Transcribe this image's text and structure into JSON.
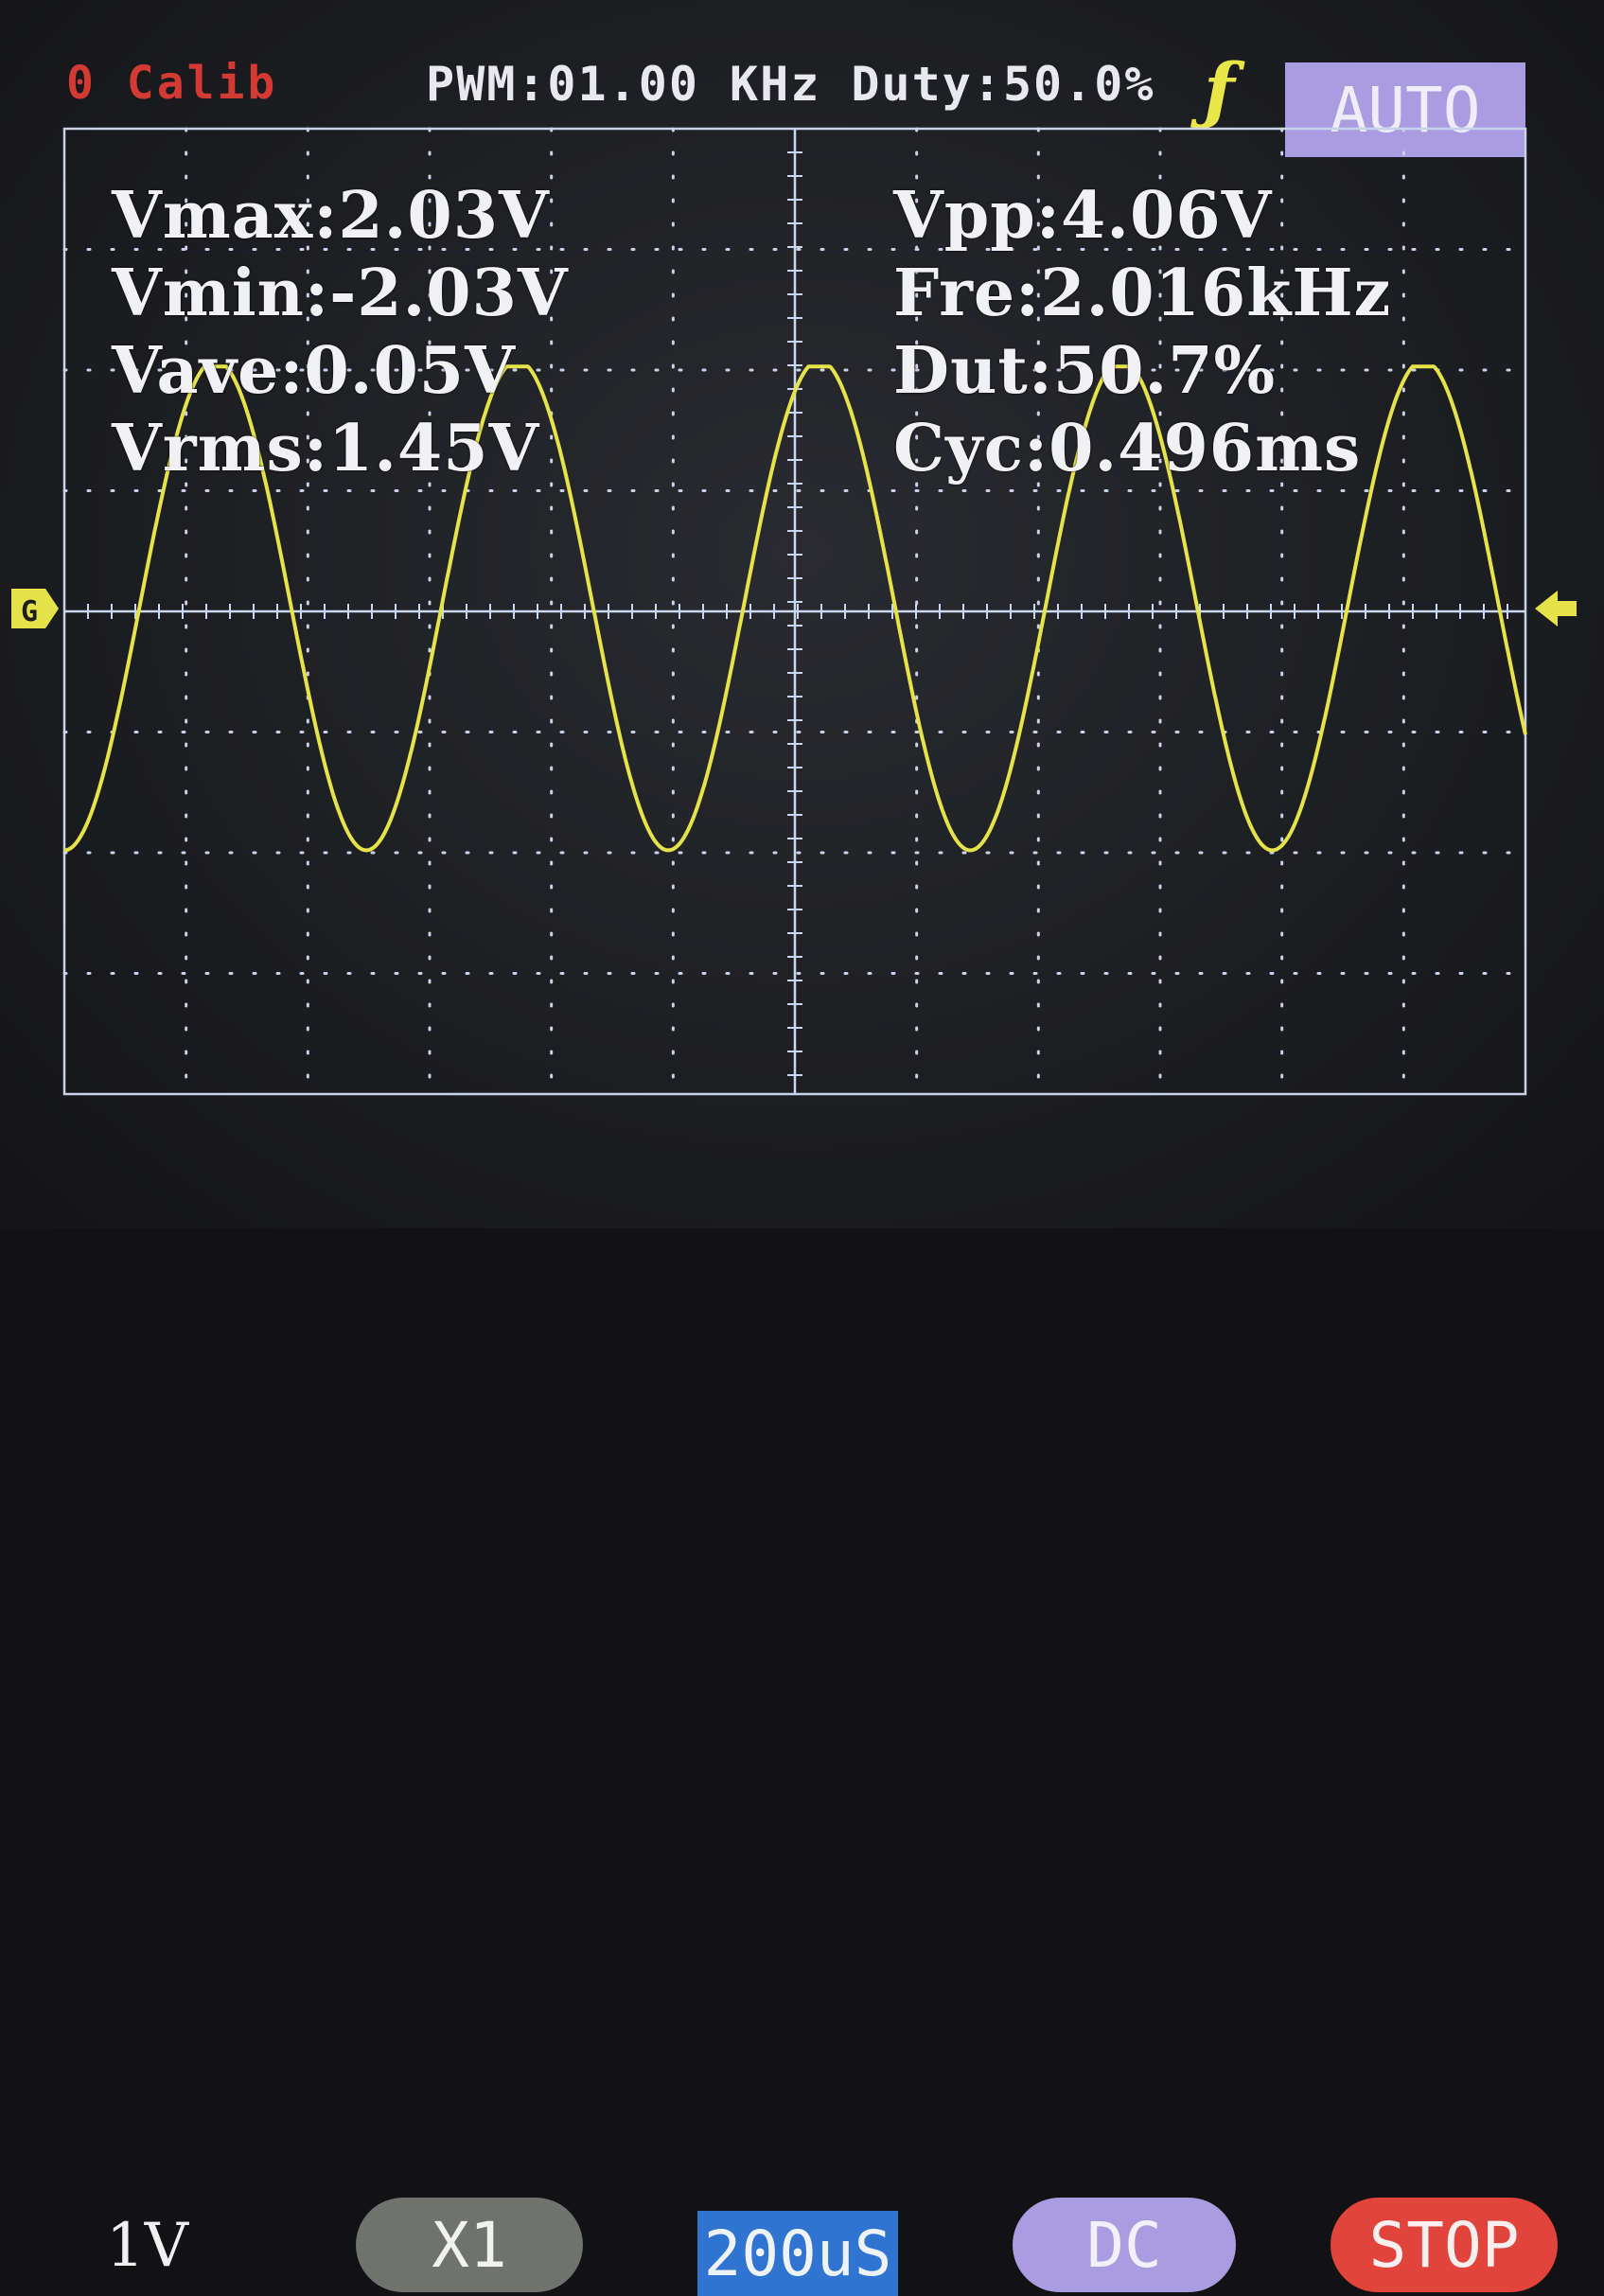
{
  "header": {
    "calib_label": "0 Calib",
    "pwm_info": "PWM:01.00 KHz Duty:50.0%",
    "trigger_edge_icon": "rising-edge-icon",
    "trigger_mode": "AUTO"
  },
  "measurements": {
    "vmax": "Vmax:2.03V",
    "vmin": "Vmin:-2.03V",
    "vave": "Vave:0.05V",
    "vrms": "Vrms:1.45V",
    "vpp": "Vpp:4.06V",
    "fre": "Fre:2.016kHz",
    "dut": "Dut:50.7%",
    "cyc": "Cyc:0.496ms"
  },
  "footer": {
    "volts_per_div": "1V",
    "probe": "X1",
    "timebase": "200uS",
    "coupling": "DC",
    "run_state": "STOP"
  },
  "colors": {
    "trace": "#e6e34a",
    "grid": "#c9d2e8",
    "axis": "#c9d7f0",
    "auto": "#a99ce0",
    "stop": "#e0443a",
    "timebase": "#2f74d0",
    "probe": "#6f726d"
  },
  "chart_data": {
    "type": "line",
    "title": "",
    "xlabel": "",
    "ylabel": "",
    "grid": true,
    "x_unit": "us",
    "y_unit": "V",
    "xlim": [
      0,
      2400
    ],
    "ylim": [
      -4,
      4
    ],
    "x_divisions": 12,
    "y_divisions": 8,
    "series": [
      {
        "amplitude": 2.03,
        "offset": 0.05,
        "frequency_khz": 2.016,
        "start_phase_deg": 180,
        "x_start": 0,
        "x_end": 2400
      }
    ]
  }
}
